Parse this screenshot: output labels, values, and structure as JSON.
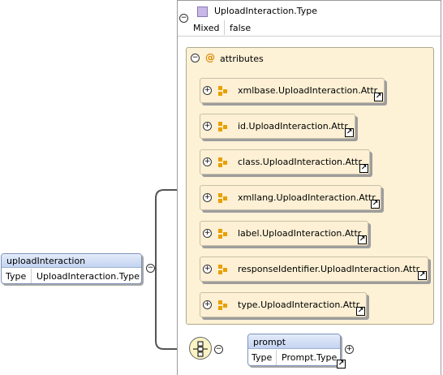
{
  "complex_type": {
    "name": "UploadInteraction.Type",
    "mixed_label": "Mixed",
    "mixed_value": "false",
    "collapse_symbol": "−",
    "icon": "complex-type-icon"
  },
  "attributes": {
    "at_symbol": "@",
    "title": "attributes",
    "collapse_symbol": "−",
    "items": [
      {
        "label": "xmlbase.UploadInteraction.Attr"
      },
      {
        "label": "id.UploadInteraction.Attr"
      },
      {
        "label": "class.UploadInteraction.Attr"
      },
      {
        "label": "xmllang.UploadInteraction.Attr"
      },
      {
        "label": "label.UploadInteraction.Attr"
      },
      {
        "label": "responseIdentifier.UploadInteraction.Attr"
      },
      {
        "label": "type.UploadInteraction.Attr"
      }
    ],
    "expand_symbol": "+",
    "link_symbol": "↗"
  },
  "element": {
    "name": "uploadInteraction",
    "type_label": "Type",
    "type_value": "UploadInteraction.Type",
    "collapse_symbol": "−"
  },
  "prompt": {
    "name": "prompt",
    "type_label": "Type",
    "type_value": "Prompt.Type",
    "collapse_symbol": "−",
    "expand_symbol": "+",
    "link_symbol": "↗"
  },
  "colors": {
    "attribute_fill": "#fdf0d4",
    "element_header": "#c3d3f0",
    "attribute_icon": "#e8a000"
  }
}
